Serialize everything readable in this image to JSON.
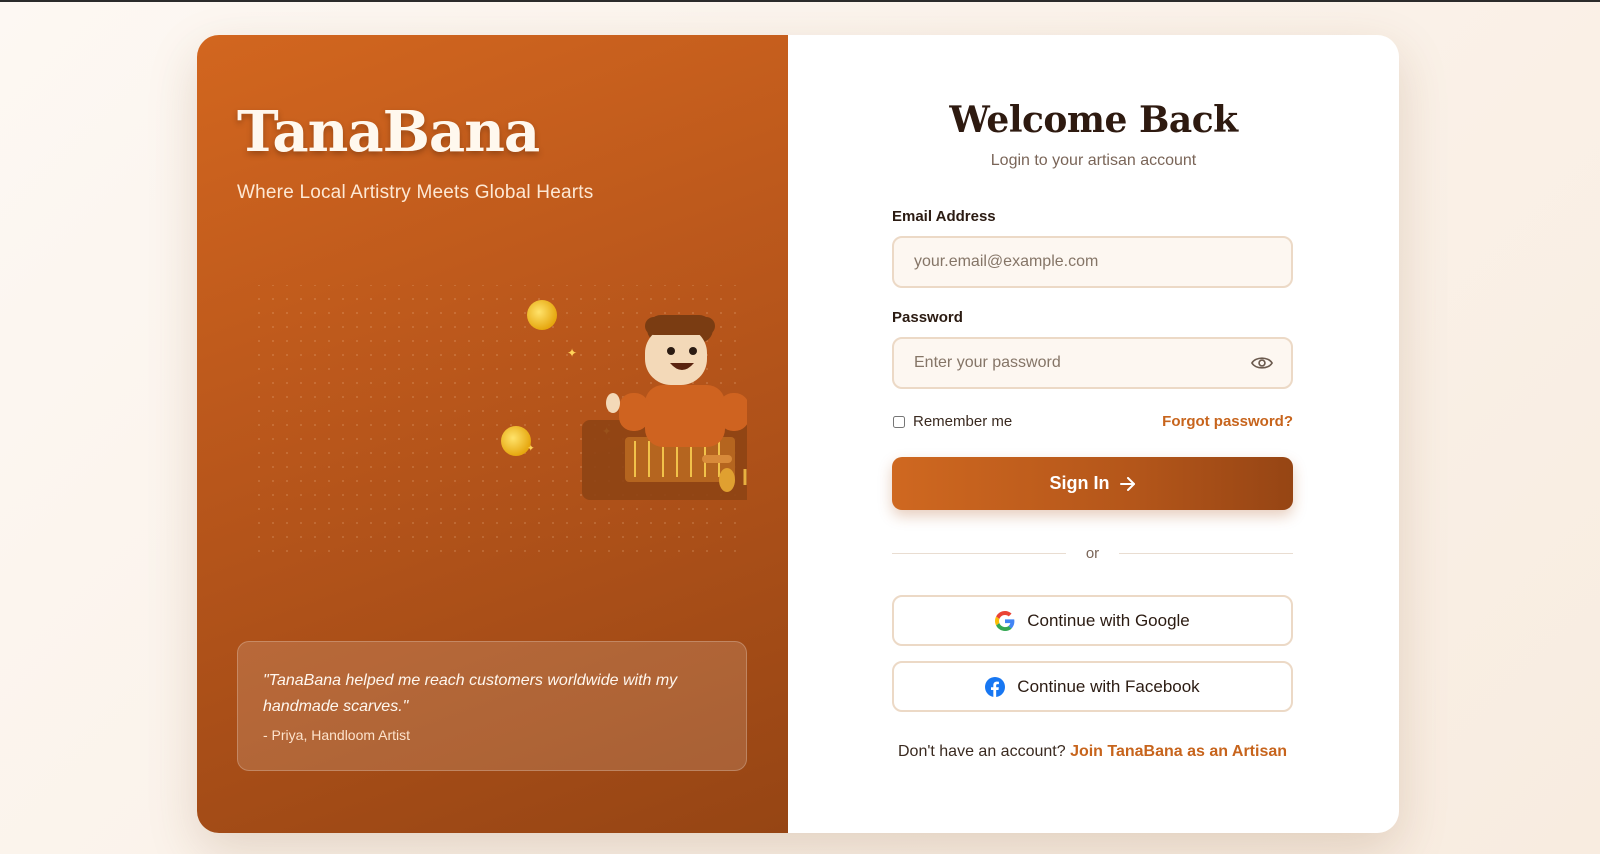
{
  "brand": {
    "name": "TanaBana",
    "tagline": "Where Local Artistry Meets Global Hearts"
  },
  "testimonial": {
    "quote": "\"TanaBana helped me reach customers worldwide with my handmade scarves.\"",
    "author": "- Priya, Handloom Artist"
  },
  "login": {
    "title": "Welcome Back",
    "subtitle": "Login to your artisan account",
    "email_label": "Email Address",
    "email_placeholder": "your.email@example.com",
    "email_value": "",
    "password_label": "Password",
    "password_placeholder": "Enter your password",
    "password_value": "",
    "remember_label": "Remember me",
    "remember_checked": false,
    "forgot_label": "Forgot password?",
    "signin_label": "Sign In",
    "divider_label": "or",
    "google_label": "Continue with Google",
    "facebook_label": "Continue with Facebook",
    "signup_prompt": "Don't have an account?",
    "signup_link": "Join TanaBana as an Artisan"
  },
  "icons": {
    "password_toggle": "eye-icon",
    "signin_arrow": "arrow-right-icon",
    "google": "google-icon",
    "facebook": "facebook-icon"
  },
  "colors": {
    "accent": "#c7641c",
    "accent_dark": "#964514",
    "panel_left_start": "#d2661f",
    "facebook_blue": "#1877f2"
  }
}
